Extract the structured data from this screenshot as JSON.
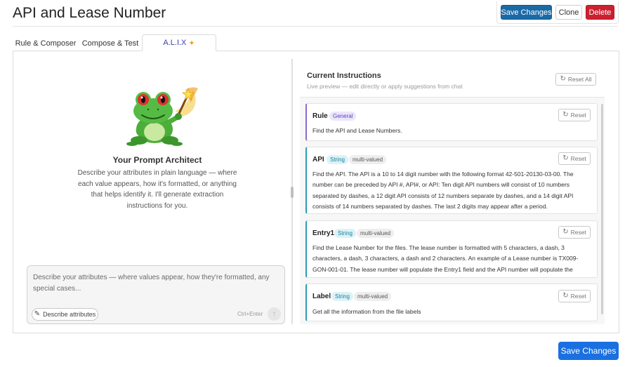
{
  "header": {
    "title": "API and Lease Number",
    "save_label": "Save Changes",
    "clone_label": "Clone",
    "delete_label": "Delete"
  },
  "tabs": [
    {
      "label": "Rule & Composer",
      "active": false
    },
    {
      "label": "Compose & Test",
      "active": false
    },
    {
      "label": "A.L.I.X",
      "active": true,
      "icon": "sparkle-icon"
    }
  ],
  "architect": {
    "title": "Your Prompt Architect",
    "description": "Describe your attributes in plain language — where each value appears, how it's formatted, or anything that helps identify it. I'll generate extraction instructions for you.",
    "placeholder": "Describe your attributes — where values appear, how they're formatted, any special cases...",
    "describe_button": "Describe attributes",
    "shortcut": "Ctrl+Enter"
  },
  "instructions": {
    "title": "Current Instructions",
    "subtitle": "Live preview — edit directly or apply suggestions from chat",
    "reset_all": "Reset All",
    "reset_label": "Reset",
    "cards": [
      {
        "name": "Rule",
        "badges": [
          "General"
        ],
        "text": "Find the API and Lease Numbers."
      },
      {
        "name": "API",
        "badges": [
          "String",
          "multi-valued"
        ],
        "text": "Find the API. The API is a 10 to 14 digit number with the following format 42-501-20130-03-00. The number can be preceded by API #, API#, or API: Ten digit API numbers will consist of 10 numbers separated by dashes, a 12 digit API consists of 12 numbers separate by dashes, and a 14 digit API consists of 14 numbers separated by dashes. The last 2 digits may appear after a period."
      },
      {
        "name": "Entry1",
        "badges": [
          "String",
          "multi-valued"
        ],
        "text": "Find the Lease Number for the files. The lease number is formatted with 5 characters, a dash, 3 characters, a dash, 3 characters, a dash and 2 characters. An example of a Lease number is TX009-GON-001-01. The lease number will populate the Entry1 field and the API number will populate the"
      },
      {
        "name": "Label",
        "badges": [
          "String",
          "multi-valued"
        ],
        "text": "Get all the information from the file labels"
      }
    ]
  },
  "footer": {
    "save_label": "Save Changes"
  },
  "colors": {
    "primary": "#1a6aa6",
    "primary_bottom": "#1a70e0",
    "danger": "#cc2030",
    "field_accent": "#2a9fb5",
    "rule_accent": "#8a6ad0",
    "tab_active_text": "#3a3ab0"
  }
}
